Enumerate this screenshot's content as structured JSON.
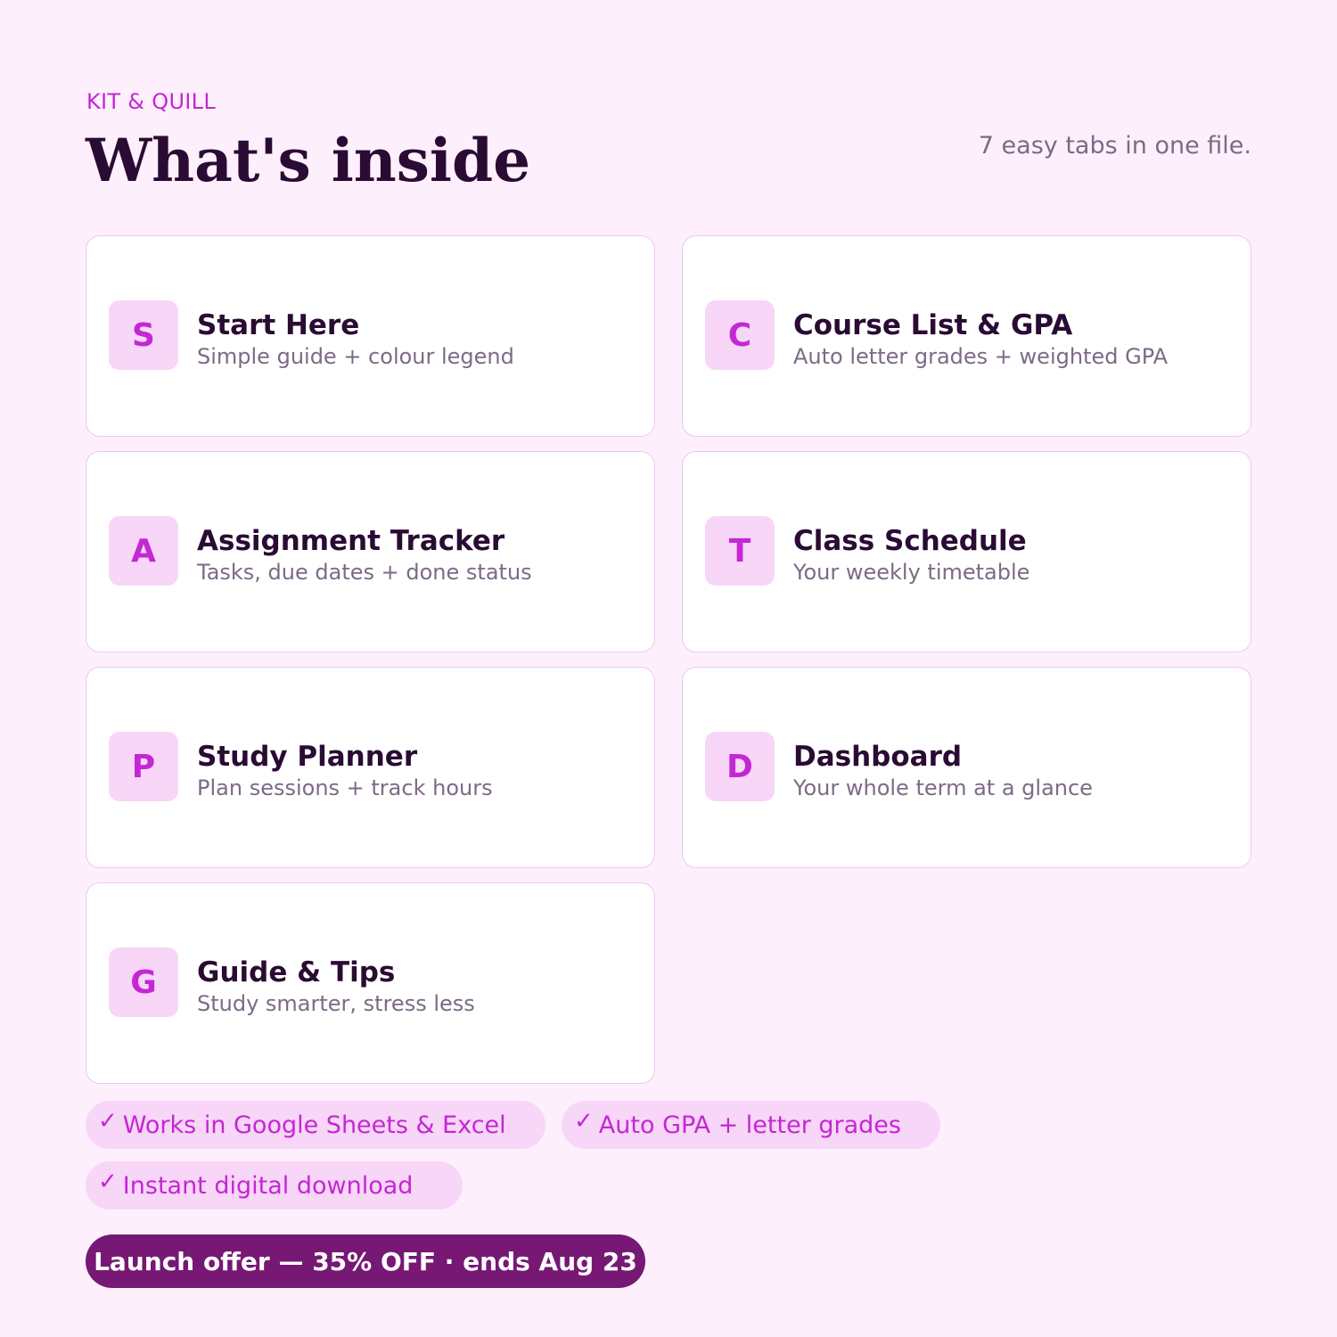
{
  "header": {
    "brand": "KIT & QUILL",
    "title": "What's inside",
    "subtitle": "7 easy tabs in one file."
  },
  "colors": {
    "background": "#fdf0fc",
    "accent": "#c427d4",
    "badge_bg": "#f7d6f7",
    "dark_text": "#2a0b33",
    "muted_text": "#7d6a86",
    "offer_bg": "#761874"
  },
  "tabs": [
    {
      "letter": "S",
      "title": "Start Here",
      "desc": "Simple guide + colour legend"
    },
    {
      "letter": "C",
      "title": "Course List & GPA",
      "desc": "Auto letter grades + weighted GPA"
    },
    {
      "letter": "A",
      "title": "Assignment Tracker",
      "desc": "Tasks, due dates + done status"
    },
    {
      "letter": "T",
      "title": "Class Schedule",
      "desc": "Your weekly timetable"
    },
    {
      "letter": "P",
      "title": "Study Planner",
      "desc": "Plan sessions + track hours"
    },
    {
      "letter": "D",
      "title": "Dashboard",
      "desc": "Your whole term at a glance"
    },
    {
      "letter": "G",
      "title": "Guide & Tips",
      "desc": "Study smarter, stress less"
    }
  ],
  "features": [
    {
      "icon": "check-icon",
      "mark": "✓",
      "label": "Works in Google Sheets & Excel"
    },
    {
      "icon": "check-icon",
      "mark": "✓",
      "label": "Auto GPA + letter grades"
    },
    {
      "icon": "check-icon",
      "mark": "✓",
      "label": "Instant digital download"
    }
  ],
  "offer": {
    "label": "Launch offer — 35% OFF · ends Aug 23"
  }
}
